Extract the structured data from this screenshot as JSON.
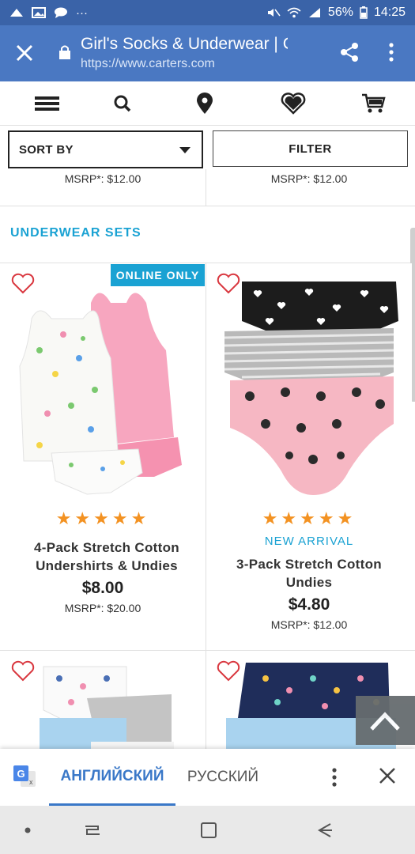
{
  "status_bar": {
    "battery": "56%",
    "time": "14:25",
    "dots": "···"
  },
  "browser": {
    "title": "Girl's Socks & Underwear | C...",
    "url": "https://www.carters.com"
  },
  "sort": {
    "label": "SORT BY"
  },
  "filter": {
    "label": "FILTER"
  },
  "previous_row": {
    "left_msrp": "MSRP*: $12.00",
    "right_msrp": "MSRP*: $12.00"
  },
  "section": {
    "title": "UNDERWEAR SETS"
  },
  "products": [
    {
      "badge": "ONLINE ONLY",
      "stars": "★★★★★",
      "name_line1": "4-Pack Stretch Cotton",
      "name_line2": "Undershirts & Undies",
      "price": "$8.00",
      "msrp": "MSRP*: $20.00"
    },
    {
      "stars": "★★★★★",
      "tag": "NEW ARRIVAL",
      "name_line1": "3-Pack Stretch Cotton",
      "name_line2": "Undies",
      "price": "$4.80",
      "msrp": "MSRP*: $12.00"
    }
  ],
  "translate": {
    "active_language": "АНГЛИЙСКИЙ",
    "other_language": "РУССКИЙ"
  },
  "colors": {
    "accent": "#1aa2d3",
    "star": "#f39222",
    "chrome": "#4a78c2",
    "heart": "#d9363e"
  }
}
